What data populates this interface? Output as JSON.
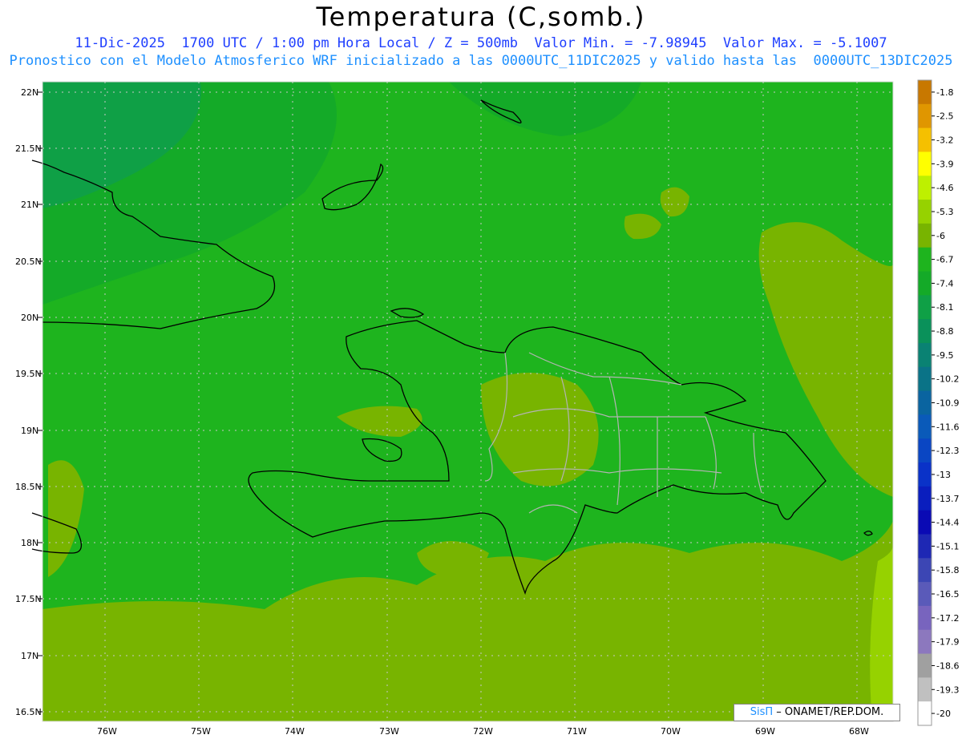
{
  "header": {
    "title": "Temperatura (C,somb.)",
    "line1": "11-Dic-2025  1700 UTC / 1:00 pm Hora Local / Z = 500mb  Valor Min. = -7.98945  Valor Max. = -5.1007",
    "line2": "Pronostico con el Modelo Atmosferico WRF inicializado a las 0000UTC_11DIC2025 y valido hasta las  0000UTC_13DIC2025"
  },
  "axes": {
    "lat_labels": [
      "22N",
      "21.5N",
      "21N",
      "20.5N",
      "20N",
      "19.5N",
      "19N",
      "18.5N",
      "18N",
      "17.5N",
      "17N",
      "16.5N"
    ],
    "lon_labels": [
      "76W",
      "75W",
      "74W",
      "73W",
      "72W",
      "71W",
      "70W",
      "69W",
      "68W"
    ]
  },
  "colorbar": {
    "labels": [
      "-1.8",
      "-2.5",
      "-3.2",
      "-3.9",
      "-4.6",
      "-5.3",
      "-6",
      "-6.7",
      "-7.4",
      "-8.1",
      "-8.8",
      "-9.5",
      "-10.2",
      "-10.9",
      "-11.6",
      "-12.3",
      "-13",
      "-13.7",
      "-14.4",
      "-15.1",
      "-15.8",
      "-16.5",
      "-17.2",
      "-17.9",
      "-18.6",
      "-19.3",
      "-20"
    ],
    "colors": [
      "#c87800",
      "#e09600",
      "#f5c000",
      "#ffff00",
      "#bef000",
      "#96d200",
      "#78b400",
      "#1eb41e",
      "#14aa28",
      "#0fa046",
      "#0a915a",
      "#0a8273",
      "#0a7387",
      "#0a64a0",
      "#0a5ab9",
      "#0a46c3",
      "#0a32c8",
      "#0a1ebe",
      "#0a0ab4",
      "#1e28b4",
      "#3c46b4",
      "#5a5ab9",
      "#7864be",
      "#8c78be",
      "#a0a0a0",
      "#c0c0c0",
      "#ffffff"
    ]
  },
  "credit": {
    "brand": "SisΠ",
    "text": " – ONAMET/REP.DOM."
  }
}
